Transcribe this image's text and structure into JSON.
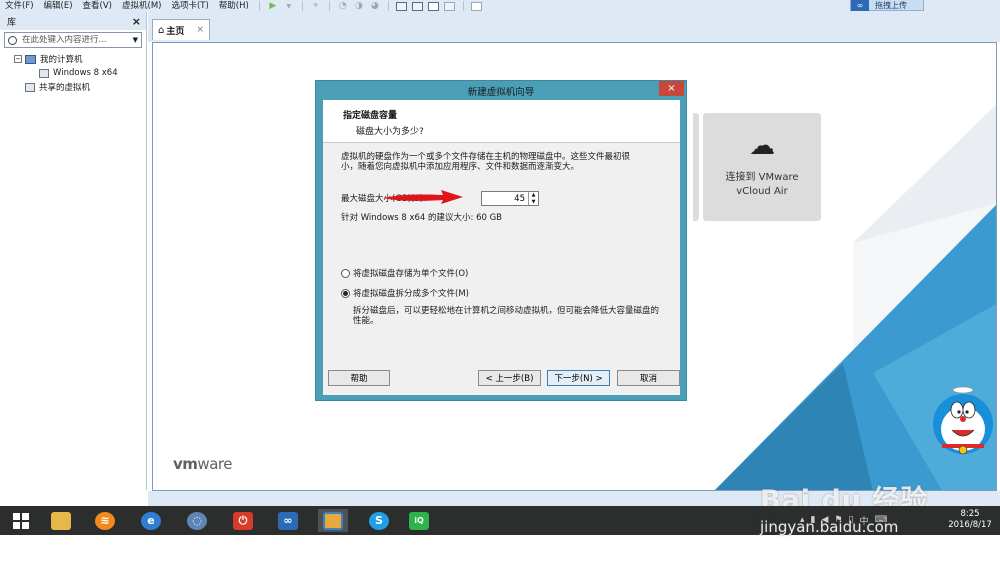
{
  "menubar": {
    "items": [
      "文件(F)",
      "编辑(E)",
      "查看(V)",
      "虚拟机(M)",
      "选项卡(T)",
      "帮助(H)"
    ],
    "upload_label": "拖拽上传"
  },
  "library": {
    "title": "库",
    "close_label": "×",
    "search_placeholder": "在此处键入内容进行...",
    "tree": {
      "my_computer": "我的计算机",
      "vm": "Windows 8 x64",
      "shared": "共享的虚拟机"
    }
  },
  "tabs": {
    "home_label": "主页",
    "close_label": "×"
  },
  "home": {
    "vcloud_line1": "连接到 VMware",
    "vcloud_line2": "vCloud Air",
    "logo_vm": "vm",
    "logo_ware": "ware"
  },
  "dialog": {
    "title": "新建虚拟机向导",
    "close_label": "×",
    "heading": "指定磁盘容量",
    "subheading": "磁盘大小为多少?",
    "description_line1": "虚拟机的硬盘作为一个或多个文件存储在主机的物理磁盘中。这些文件最初很",
    "description_line2": "小，随着您向虚拟机中添加应用程序、文件和数据而逐渐变大。",
    "size_label": "最大磁盘大小(GB)(S):",
    "size_value": "45",
    "recommend": "针对 Windows 8 x64 的建议大小: 60 GB",
    "option_single": "将虚拟磁盘存储为单个文件(O)",
    "option_split": "将虚拟磁盘拆分成多个文件(M)",
    "split_note_line1": "拆分磁盘后，可以更轻松地在计算机之间移动虚拟机，但可能会降低大容量磁盘的",
    "split_note_line2": "性能。",
    "buttons": {
      "help": "帮助",
      "back": "< 上一步(B)",
      "next": "下一步(N) >",
      "cancel": "取消"
    }
  },
  "taskbar": {
    "clock_time": "8:25",
    "clock_date": "2016/8/17",
    "tray_lang": "中"
  },
  "watermark": {
    "brand": "Bai du 经验",
    "url": "jingyan.baidu.com"
  },
  "colors": {
    "dialog_frame": "#4a9fb6",
    "close_red": "#c7473b",
    "tri_blue": "#3d9fd0",
    "taskbar": "#2c2e2e"
  }
}
